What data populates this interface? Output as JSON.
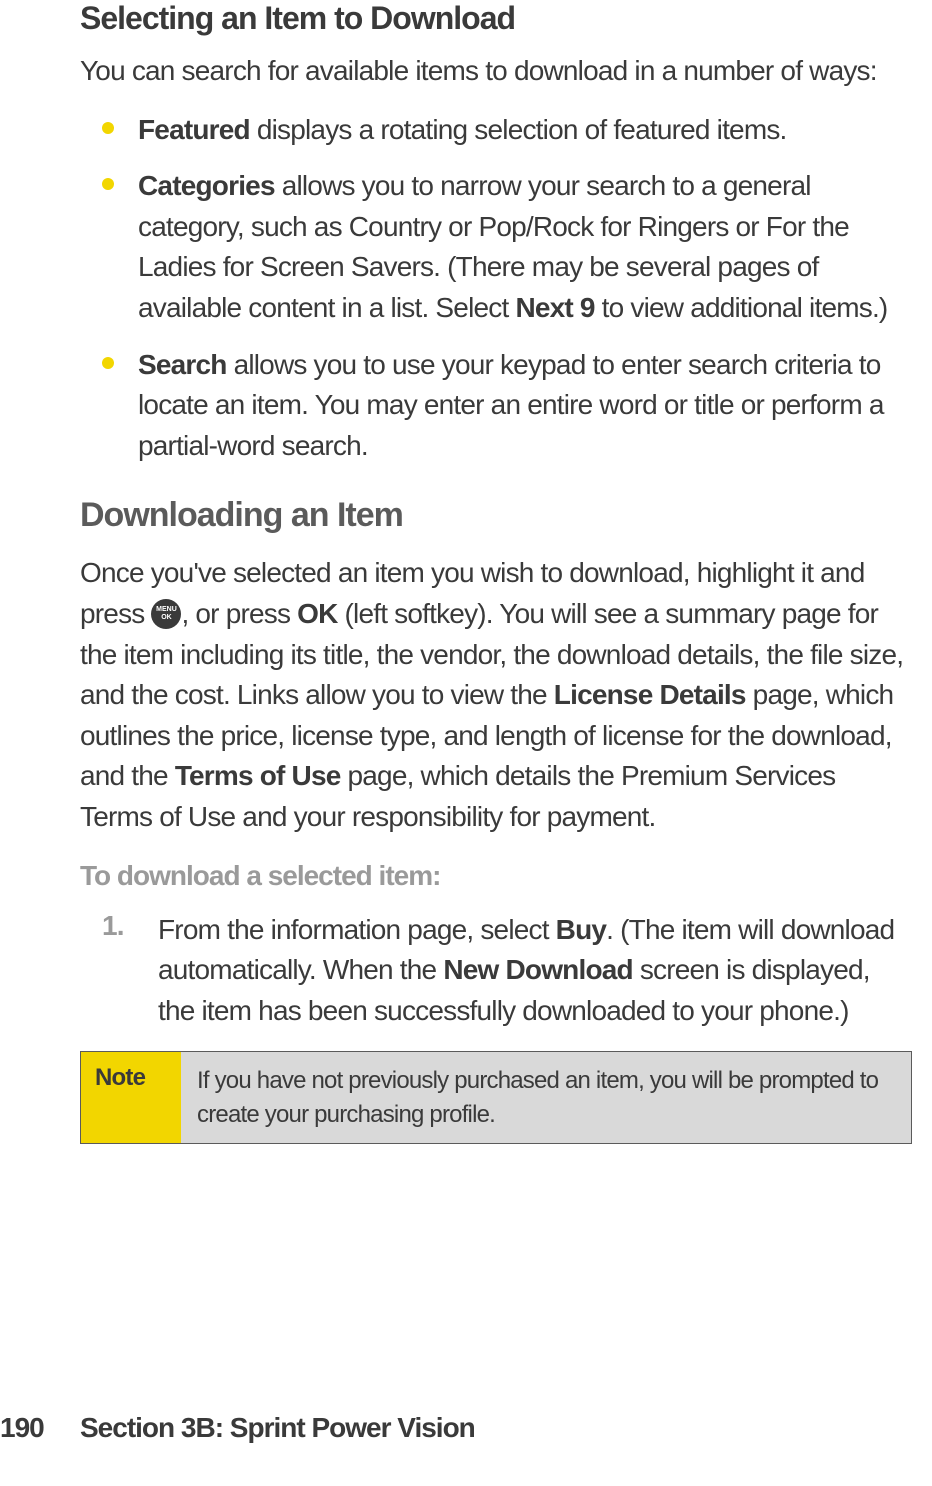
{
  "section1": {
    "heading": "Selecting an Item to Download",
    "intro": "You can search for available items to download in a number of ways:",
    "bullets": [
      {
        "bold": "Featured",
        "rest": " displays a rotating selection of featured items."
      },
      {
        "bold": "Categories",
        "rest_a": " allows you to narrow your search to a general category, such as Country or Pop/Rock for Ringers or For the Ladies for Screen Savers. (There may be several pages of available content in a list. Select ",
        "bold2": "Next 9",
        "rest_b": " to view additional items.)"
      },
      {
        "bold": "Search",
        "rest": " allows you to use your keypad to enter search criteria to locate an item. You may enter an entire word or title or perform a partial-word search."
      }
    ]
  },
  "section2": {
    "heading": "Downloading an Item",
    "para": {
      "a": "Once you've selected an item you wish to download, highlight it and press ",
      "icon_top": "MENU",
      "icon_bot": "OK",
      "b": ", or press ",
      "bold_ok": "OK",
      "c": " (left softkey). You will see a summary page for the item including its title, the vendor, the download details, the file size, and the cost. Links allow you to view the ",
      "bold_license": "License Details",
      "d": " page, which outlines the price, license type, and length of license for the download, and the ",
      "bold_terms": "Terms of Use",
      "e": " page, which details the Premium Services Terms of Use and your responsibility for payment."
    },
    "subhead": "To download a selected item:",
    "step1": {
      "marker": "1.",
      "a": "From the information page, select ",
      "bold_buy": "Buy",
      "b": ". (The item will download automatically. When the ",
      "bold_newdl": "New Download",
      "c": " screen is displayed, the item has been successfully downloaded to your phone.)"
    }
  },
  "note": {
    "label": "Note",
    "text": "If you have not previously purchased an item, you will be prompted to create your purchasing profile."
  },
  "footer": {
    "page": "190",
    "section": "Section 3B: Sprint Power Vision"
  }
}
